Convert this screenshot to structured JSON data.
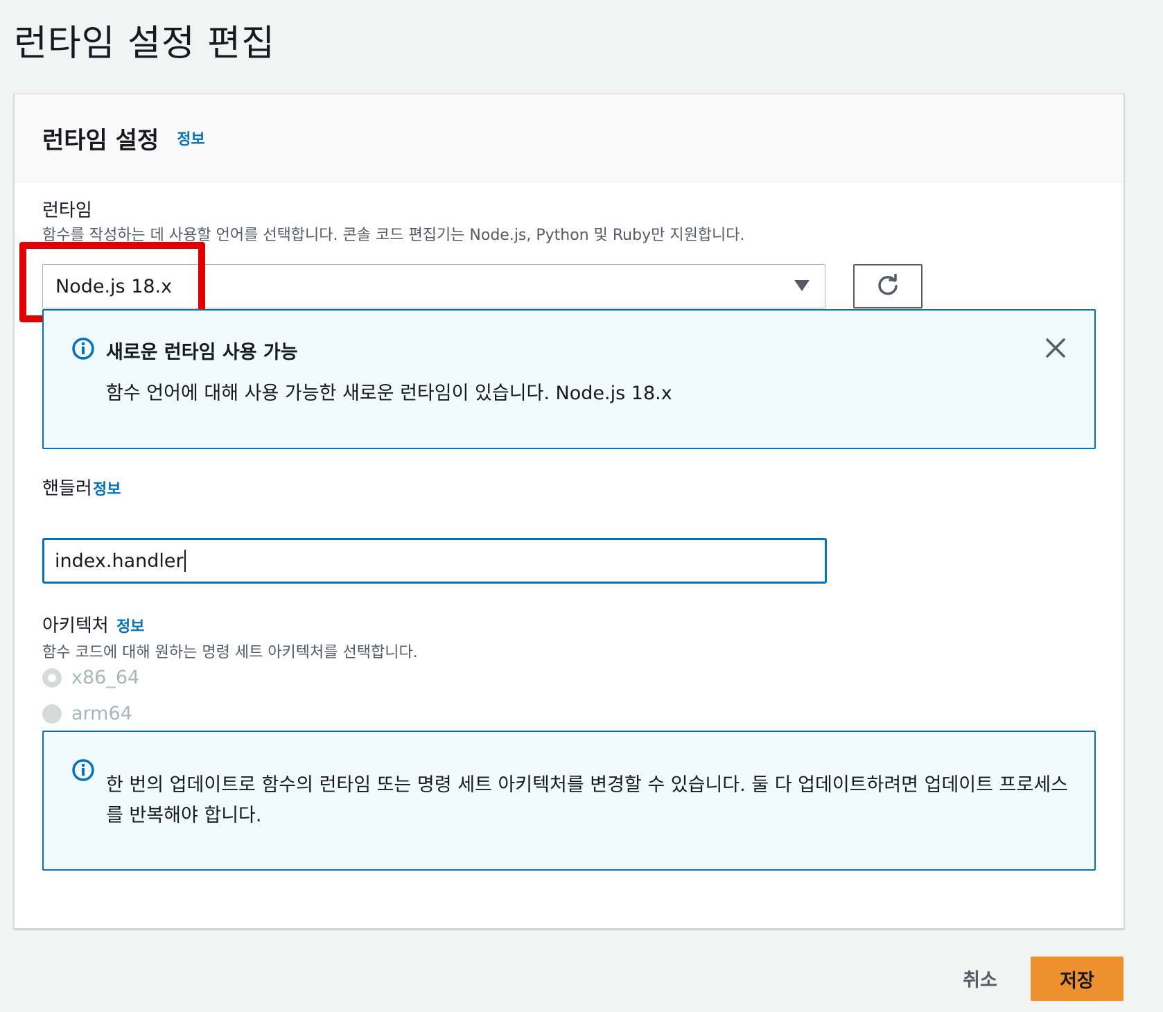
{
  "page": {
    "title": "런타임 설정 편집"
  },
  "card": {
    "title": "런타임 설정",
    "info": "정보"
  },
  "runtime": {
    "label": "런타임",
    "description": "함수를 작성하는 데 사용할 언어를 선택합니다. 콘솔 코드 편집기는 Node.js, Python 및 Ruby만 지원합니다.",
    "selected": "Node.js 18.x"
  },
  "runtime_alert": {
    "title": "새로운 런타임 사용 가능",
    "body": "함수 언어에 대해 사용 가능한 새로운 런타임이 있습니다. Node.js 18.x"
  },
  "handler": {
    "label": "핸들러",
    "info": "정보",
    "value": "index.handler"
  },
  "architecture": {
    "label": "아키텍처",
    "info": "정보",
    "description": "함수 코드에 대해 원하는 명령 세트 아키텍처를 선택합니다.",
    "options": [
      "x86_64",
      "arm64"
    ],
    "selected": "x86_64"
  },
  "arch_alert": {
    "body": "한 번의 업데이트로 함수의 런타임 또는 명령 세트 아키텍처를 변경할 수 있습니다. 둘 다 업데이트하려면 업데이트 프로세스를 반복해야 합니다."
  },
  "footer": {
    "cancel": "취소",
    "save": "저장"
  },
  "colors": {
    "link": "#0073bb",
    "primary_button": "#ec912d",
    "alert_border": "#0073bb",
    "alert_bg": "#f1faff",
    "highlight": "#e00000"
  },
  "icons": [
    "refresh-icon",
    "info-icon",
    "close-icon",
    "dropdown-caret-icon"
  ]
}
